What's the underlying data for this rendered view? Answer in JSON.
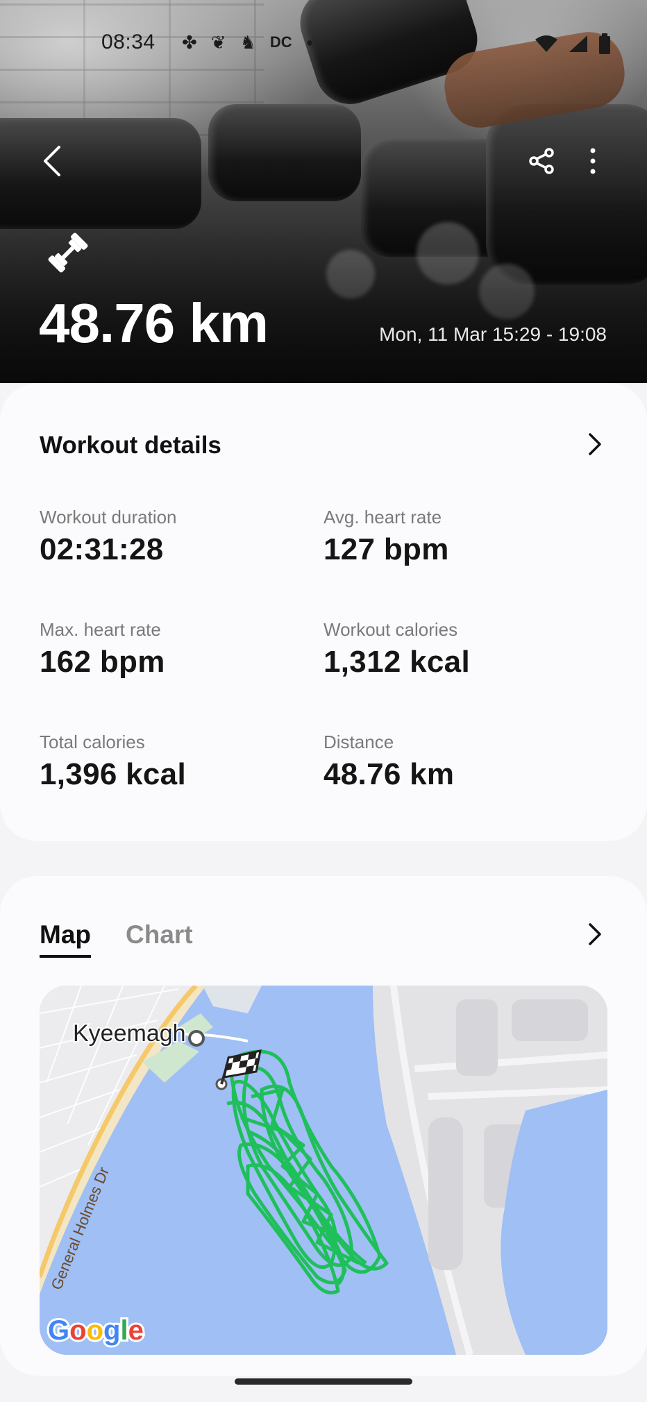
{
  "status_bar": {
    "time": "08:34",
    "notification_icons": [
      "pinwheel-icon",
      "bird-icon",
      "person-icon",
      "dc-icon",
      "dot-icon"
    ],
    "dc_text": "DC"
  },
  "hero": {
    "workout_icon": "dumbbell-icon",
    "distance": "48.76 km",
    "date_range": "Mon, 11 Mar 15:29 - 19:08"
  },
  "workout_details": {
    "title": "Workout details",
    "stats": [
      {
        "label": "Workout duration",
        "value": "02:31:28"
      },
      {
        "label": "Avg. heart rate",
        "value": "127 bpm"
      },
      {
        "label": "Max. heart rate",
        "value": "162 bpm"
      },
      {
        "label": "Workout calories",
        "value": "1,312 kcal"
      },
      {
        "label": "Total calories",
        "value": "1,396 kcal"
      },
      {
        "label": "Distance",
        "value": "48.76 km"
      }
    ]
  },
  "map_card": {
    "tabs": [
      {
        "label": "Map",
        "active": true
      },
      {
        "label": "Chart",
        "active": false
      }
    ],
    "map": {
      "place_label": "Kyeemagh",
      "road_label": "General Holmes Dr",
      "attribution": "Google",
      "route_color": "#1fbf5a",
      "water_color": "#9fbff5"
    }
  }
}
